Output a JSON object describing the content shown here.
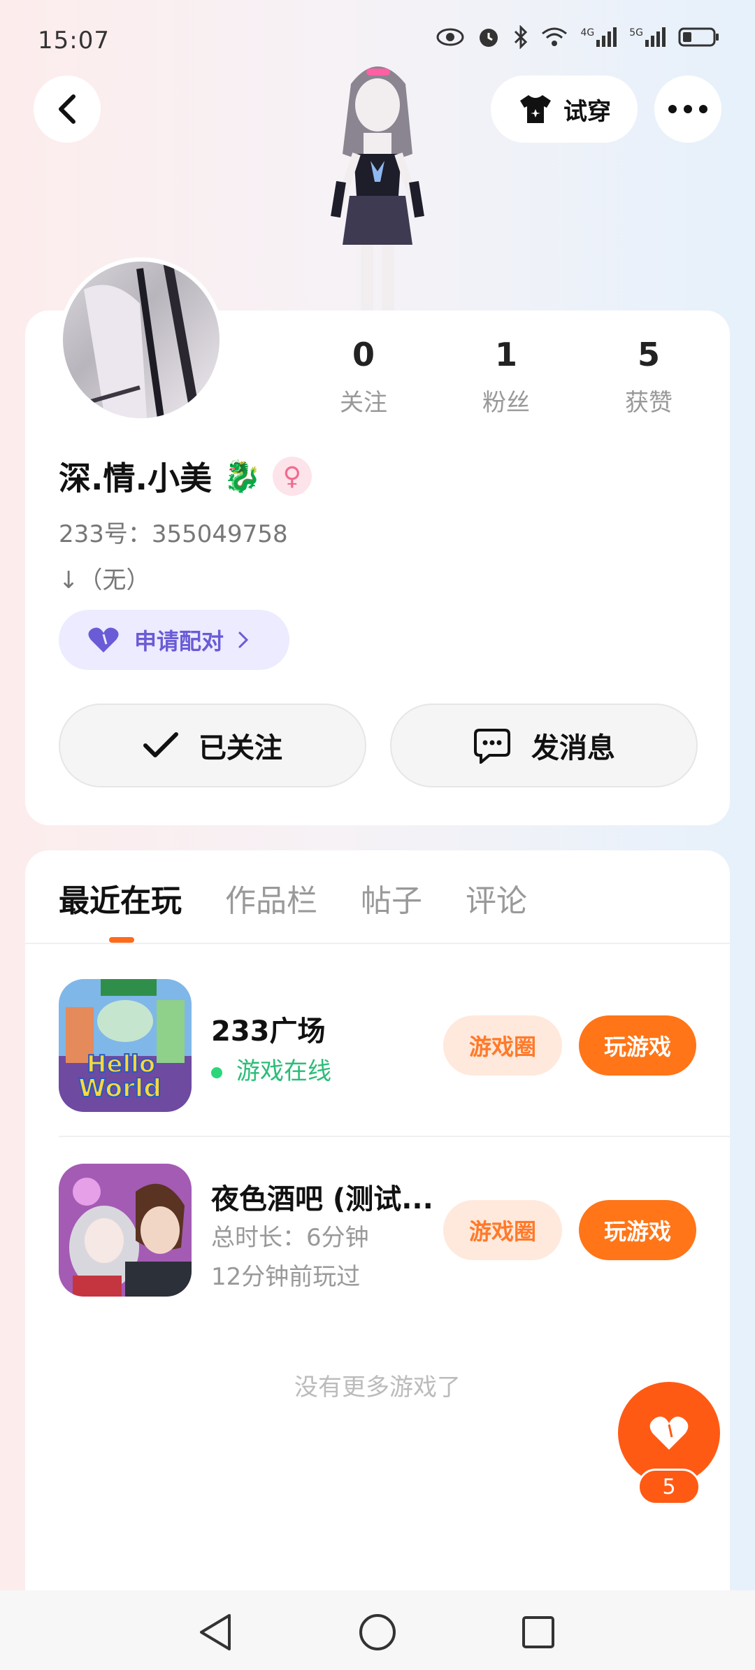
{
  "status_bar": {
    "time": "15:07",
    "network_1": "4G",
    "network_2": "5G"
  },
  "header": {
    "tryon_label": "试穿"
  },
  "profile": {
    "username": "深.情.小美",
    "dragon_emoji": "🐉",
    "gender_symbol": "♀",
    "user_id": "233号：355049758",
    "bio": "↓（无）",
    "pair_label": "申请配对",
    "stats": [
      {
        "value": "0",
        "label": "关注"
      },
      {
        "value": "1",
        "label": "粉丝"
      },
      {
        "value": "5",
        "label": "获赞"
      }
    ],
    "follow_label": "已关注",
    "message_label": "发消息"
  },
  "tabs": [
    {
      "label": "最近在玩",
      "active": true
    },
    {
      "label": "作品栏",
      "active": false
    },
    {
      "label": "帖子",
      "active": false
    },
    {
      "label": "评论",
      "active": false
    }
  ],
  "games": [
    {
      "title": "233广场",
      "status": "游戏在线",
      "icon_text_1": "Hello",
      "icon_text_2": "World",
      "circle_label": "游戏圈",
      "play_label": "玩游戏"
    },
    {
      "title": "夜色酒吧 (测试...",
      "duration": "总时长：6分钟",
      "last_played": "12分钟前玩过",
      "circle_label": "游戏圈",
      "play_label": "玩游戏"
    }
  ],
  "no_more_text": "没有更多游戏了",
  "like": {
    "count": "5"
  },
  "colors": {
    "accent": "#ff7517",
    "online": "#2bbd78",
    "pair": "#6a5bd6"
  }
}
